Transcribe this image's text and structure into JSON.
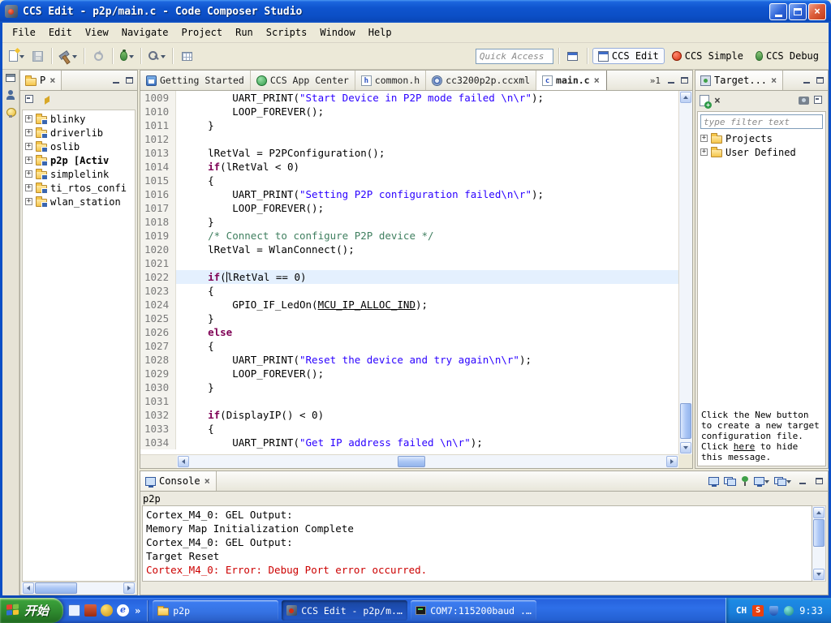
{
  "window": {
    "title": "CCS Edit - p2p/main.c - Code Composer Studio"
  },
  "menu": {
    "items": [
      "File",
      "Edit",
      "View",
      "Navigate",
      "Project",
      "Run",
      "Scripts",
      "Window",
      "Help"
    ]
  },
  "toolbar": {
    "quick_access_placeholder": "Quick Access",
    "perspectives": [
      {
        "label": "CCS Edit",
        "active": true
      },
      {
        "label": "CCS Simple",
        "active": false
      },
      {
        "label": "CCS Debug",
        "active": false
      }
    ]
  },
  "project_explorer": {
    "tab_label": "P",
    "items": [
      {
        "label": "blinky",
        "bold": false
      },
      {
        "label": "driverlib",
        "bold": false
      },
      {
        "label": "oslib",
        "bold": false
      },
      {
        "label": "p2p  [Activ",
        "bold": true
      },
      {
        "label": "simplelink",
        "bold": false
      },
      {
        "label": "ti_rtos_confi",
        "bold": false
      },
      {
        "label": "wlan_station",
        "bold": false
      }
    ]
  },
  "editor": {
    "tabs": [
      {
        "label": "Getting Started",
        "icon": "home",
        "active": false,
        "closable": false
      },
      {
        "label": "CCS App Center",
        "icon": "app",
        "active": false,
        "closable": false
      },
      {
        "label": "common.h",
        "icon": "h-file",
        "active": false,
        "closable": false
      },
      {
        "label": "cc3200p2p.ccxml",
        "icon": "ccxml",
        "active": false,
        "closable": false
      },
      {
        "label": "main.c",
        "icon": "c-file",
        "active": true,
        "closable": true
      }
    ],
    "overflow_indicator": "»1",
    "code": {
      "current_line": 1022,
      "lines": [
        {
          "n": 1009,
          "seg": [
            {
              "t": "p",
              "x": "        UART_PRINT("
            },
            {
              "t": "s",
              "x": "\"Start Device in P2P mode failed \\n\\r\""
            },
            {
              "t": "p",
              "x": ");"
            }
          ]
        },
        {
          "n": 1010,
          "seg": [
            {
              "t": "p",
              "x": "        LOOP_FOREVER();"
            }
          ]
        },
        {
          "n": 1011,
          "seg": [
            {
              "t": "p",
              "x": "    }"
            }
          ]
        },
        {
          "n": 1012,
          "seg": []
        },
        {
          "n": 1013,
          "seg": [
            {
              "t": "p",
              "x": "    lRetVal = P2PConfiguration();"
            }
          ]
        },
        {
          "n": 1014,
          "seg": [
            {
              "t": "p",
              "x": "    "
            },
            {
              "t": "k",
              "x": "if"
            },
            {
              "t": "p",
              "x": "(lRetVal < 0)"
            }
          ]
        },
        {
          "n": 1015,
          "seg": [
            {
              "t": "p",
              "x": "    {"
            }
          ]
        },
        {
          "n": 1016,
          "seg": [
            {
              "t": "p",
              "x": "        UART_PRINT("
            },
            {
              "t": "s",
              "x": "\"Setting P2P configuration failed\\n\\r\""
            },
            {
              "t": "p",
              "x": ");"
            }
          ]
        },
        {
          "n": 1017,
          "seg": [
            {
              "t": "p",
              "x": "        LOOP_FOREVER();"
            }
          ]
        },
        {
          "n": 1018,
          "seg": [
            {
              "t": "p",
              "x": "    }"
            }
          ]
        },
        {
          "n": 1019,
          "seg": [
            {
              "t": "p",
              "x": "    "
            },
            {
              "t": "c",
              "x": "/* Connect to configure P2P device */"
            }
          ]
        },
        {
          "n": 1020,
          "seg": [
            {
              "t": "p",
              "x": "    lRetVal = WlanConnect();"
            }
          ]
        },
        {
          "n": 1021,
          "seg": []
        },
        {
          "n": 1022,
          "seg": [
            {
              "t": "p",
              "x": "    "
            },
            {
              "t": "k",
              "x": "if"
            },
            {
              "t": "p",
              "x": "("
            },
            {
              "t": "caret",
              "x": ""
            },
            {
              "t": "p",
              "x": "lRetVal == 0)"
            }
          ]
        },
        {
          "n": 1023,
          "seg": [
            {
              "t": "p",
              "x": "    {"
            }
          ]
        },
        {
          "n": 1024,
          "seg": [
            {
              "t": "p",
              "x": "        GPIO_IF_LedOn("
            },
            {
              "t": "m",
              "x": "MCU_IP_ALLOC_IND"
            },
            {
              "t": "p",
              "x": ");"
            }
          ]
        },
        {
          "n": 1025,
          "seg": [
            {
              "t": "p",
              "x": "    }"
            }
          ]
        },
        {
          "n": 1026,
          "seg": [
            {
              "t": "p",
              "x": "    "
            },
            {
              "t": "k",
              "x": "else"
            }
          ]
        },
        {
          "n": 1027,
          "seg": [
            {
              "t": "p",
              "x": "    {"
            }
          ]
        },
        {
          "n": 1028,
          "seg": [
            {
              "t": "p",
              "x": "        UART_PRINT("
            },
            {
              "t": "s",
              "x": "\"Reset the device and try again\\n\\r\""
            },
            {
              "t": "p",
              "x": ");"
            }
          ]
        },
        {
          "n": 1029,
          "seg": [
            {
              "t": "p",
              "x": "        LOOP_FOREVER();"
            }
          ]
        },
        {
          "n": 1030,
          "seg": [
            {
              "t": "p",
              "x": "    }"
            }
          ]
        },
        {
          "n": 1031,
          "seg": []
        },
        {
          "n": 1032,
          "seg": [
            {
              "t": "p",
              "x": "    "
            },
            {
              "t": "k",
              "x": "if"
            },
            {
              "t": "p",
              "x": "(DisplayIP() < 0)"
            }
          ]
        },
        {
          "n": 1033,
          "seg": [
            {
              "t": "p",
              "x": "    {"
            }
          ]
        },
        {
          "n": 1034,
          "seg": [
            {
              "t": "p",
              "x": "        UART_PRINT("
            },
            {
              "t": "s",
              "x": "\"Get IP address failed \\n\\r\""
            },
            {
              "t": "p",
              "x": ");"
            }
          ]
        }
      ]
    }
  },
  "target_panel": {
    "tab_label": "Target...",
    "filter_placeholder": "type filter text",
    "tree": [
      {
        "label": "Projects"
      },
      {
        "label": "User Defined"
      }
    ],
    "message": {
      "pre": "Click the New button to create a new target configuration file. Click ",
      "link": "here",
      "post": " to hide this message."
    }
  },
  "console": {
    "tab_label": "Console",
    "console_name": "p2p",
    "lines": [
      {
        "text": "Cortex_M4_0: GEL Output:",
        "error": false
      },
      {
        "text": "Memory Map Initialization Complete",
        "error": false
      },
      {
        "text": "Cortex_M4_0: GEL Output:",
        "error": false
      },
      {
        "text": "Target Reset",
        "error": false
      },
      {
        "text": "Cortex_M4_0: Error: Debug Port error occurred.",
        "error": true
      }
    ]
  },
  "taskbar": {
    "start_label": "开始",
    "quick_launch_overflow": "»",
    "tasks": [
      {
        "label": "p2p",
        "icon": "folder",
        "pressed": false
      },
      {
        "label": "CCS Edit - p2p/m...",
        "icon": "ccs",
        "pressed": true
      },
      {
        "label": "COM7:115200baud ...",
        "icon": "terminal",
        "pressed": false
      }
    ],
    "tray": {
      "lang": "CH",
      "ime": "S",
      "time": "9:33"
    }
  },
  "colors": {
    "keyword": "#7F0055",
    "string": "#2A00FF",
    "comment": "#3F7F5F",
    "error": "#CC0000",
    "current_line_highlight": "#E4F0FE",
    "titlebar_blue": "#0C4FC6",
    "taskbar_blue": "#2460D2",
    "start_green": "#2F8A2F"
  }
}
